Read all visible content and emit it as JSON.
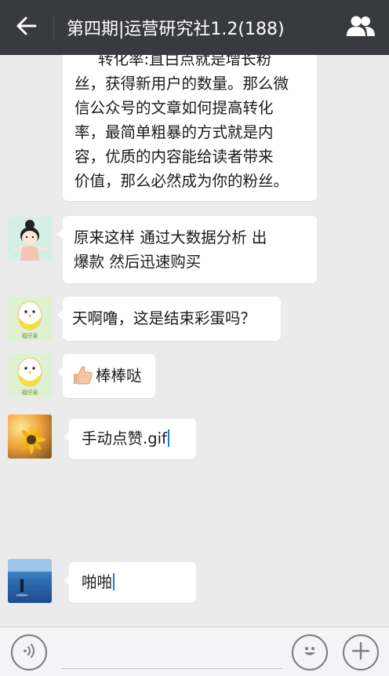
{
  "header": {
    "title": "第四期|运营研究社1.2(188)",
    "back_icon": "back-arrow-icon",
    "members_icon": "group-members-icon",
    "bg_color": "#393a3f"
  },
  "messages": [
    {
      "type": "text",
      "lines": [
        "转化率:直白点就是增长粉",
        "丝，获得新用户的数量。那么微",
        "信公众号的文章如何提高转化",
        "率，最简单粗暴的方式就是内",
        "容，优质的内容能给读者带来",
        "价值，那么必然成为你的粉丝。"
      ]
    },
    {
      "type": "text",
      "avatar": "cartoon-girl-avatar",
      "lines": [
        "原来这样   通过大数据分析  出",
        "爆款  然后迅速购买"
      ]
    },
    {
      "type": "text",
      "avatar": "egg-chick-avatar",
      "avatar_caption": "福仔泉",
      "lines": [
        "天啊噜，这是结束彩蛋吗？"
      ]
    },
    {
      "type": "text",
      "avatar": "egg-chick-avatar",
      "avatar_caption": "福仔泉",
      "emoji": "thumbs-up-emoji",
      "lines": [
        "棒棒哒"
      ]
    },
    {
      "type": "text",
      "avatar": "sunflower-avatar",
      "lines": [
        "手动点赞.gif"
      ]
    },
    {
      "type": "text",
      "avatar": "beach-person-avatar",
      "lines": [
        "啪啪"
      ]
    }
  ],
  "input_bar": {
    "voice_icon": "voice-input-icon",
    "emoji_icon": "emoji-smile-icon",
    "plus_icon": "plus-icon"
  }
}
